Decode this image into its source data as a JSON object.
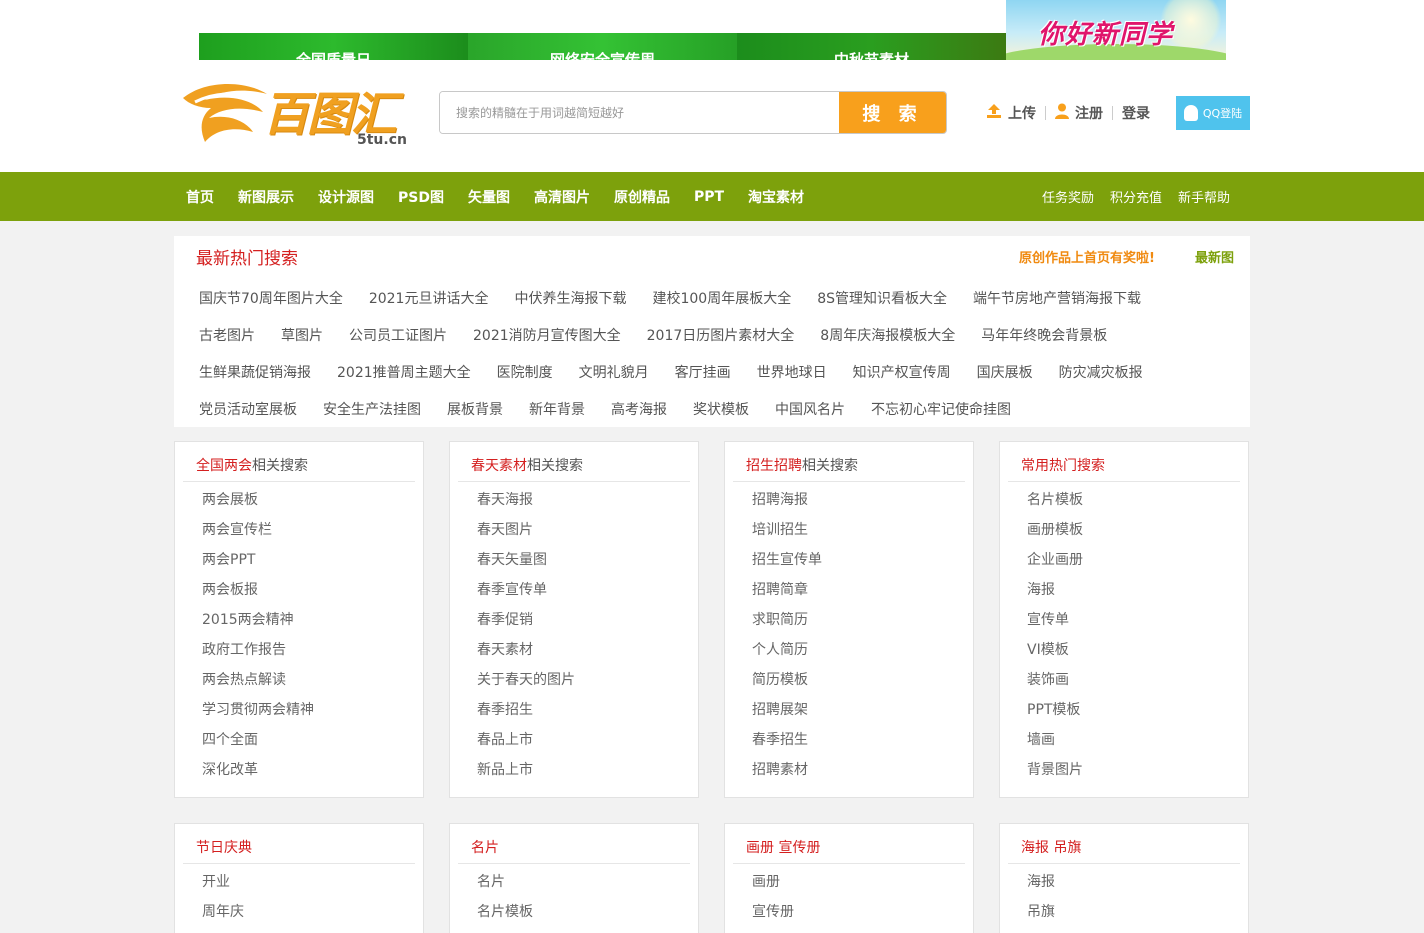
{
  "top_banners": [
    "全国质量日",
    "网络安全宣传周",
    "中秋节素材"
  ],
  "promo": {
    "text": "你好新同学"
  },
  "logo": {
    "name": "百图汇",
    "domain": "5tu.cn"
  },
  "search": {
    "placeholder": "搜索的精髓在于用词越简短越好",
    "button": "搜 索"
  },
  "user_links": {
    "upload": "上传",
    "register": "注册",
    "login": "登录",
    "qq_login": "QQ登陆"
  },
  "nav": {
    "items": [
      "首页",
      "新图展示",
      "设计源图",
      "PSD图",
      "矢量图",
      "高清图片",
      "原创精品",
      "PPT",
      "淘宝素材"
    ],
    "right": [
      "任务奖励",
      "积分充值",
      "新手帮助"
    ]
  },
  "hot_search": {
    "title": "最新热门搜索",
    "promo": "原创作品上首页有奖啦!",
    "latest": "最新图",
    "rows": [
      [
        "国庆节70周年图片大全",
        "2021元旦讲话大全",
        "中伏养生海报下载",
        "建校100周年展板大全",
        "8S管理知识看板大全",
        "端午节房地产营销海报下载"
      ],
      [
        "古老图片",
        "草图片",
        "公司员工证图片",
        "2021消防月宣传图大全",
        "2017日历图片素材大全",
        "8周年庆海报模板大全",
        "马年年终晚会背景板"
      ],
      [
        "生鲜果蔬促销海报",
        "2021推普周主题大全",
        "医院制度",
        "文明礼貌月",
        "客厅挂画",
        "世界地球日",
        "知识产权宣传周",
        "国庆展板",
        "防灾减灾板报"
      ],
      [
        "党员活动室展板",
        "安全生产法挂图",
        "展板背景",
        "新年背景",
        "高考海报",
        "奖状模板",
        "中国风名片",
        "不忘初心牢记使命挂图"
      ]
    ]
  },
  "categories_row1": [
    {
      "key": "全国两会",
      "suffix": "相关搜索",
      "items": [
        "两会展板",
        "两会宣传栏",
        "两会PPT",
        "两会板报",
        "2015两会精神",
        "政府工作报告",
        "两会热点解读",
        "学习贯彻两会精神",
        "四个全面",
        "深化改革"
      ]
    },
    {
      "key": "春天素材",
      "suffix": "相关搜索",
      "items": [
        "春天海报",
        "春天图片",
        "春天矢量图",
        "春季宣传单",
        "春季促销",
        "春天素材",
        "关于春天的图片",
        "春季招生",
        "春品上市",
        "新品上市"
      ]
    },
    {
      "key": "招生招聘",
      "suffix": "相关搜索",
      "items": [
        "招聘海报",
        "培训招生",
        "招生宣传单",
        "招聘简章",
        "求职简历",
        "个人简历",
        "简历模板",
        "招聘展架",
        "春季招生",
        "招聘素材"
      ]
    },
    {
      "key": "常用热门搜索",
      "suffix": "",
      "items": [
        "名片模板",
        "画册模板",
        "企业画册",
        "海报",
        "宣传单",
        "VI模板",
        "装饰画",
        "PPT模板",
        "墙画",
        "背景图片"
      ]
    }
  ],
  "categories_row2": [
    {
      "key": "节日庆典",
      "suffix": "",
      "items": [
        "开业",
        "周年庆"
      ]
    },
    {
      "key": "名片",
      "suffix": "",
      "items": [
        "名片",
        "名片模板"
      ]
    },
    {
      "key": "画册 宣传册",
      "suffix": "",
      "items": [
        "画册",
        "宣传册"
      ]
    },
    {
      "key": "海报 吊旗",
      "suffix": "",
      "items": [
        "海报",
        "吊旗"
      ]
    }
  ],
  "colors": {
    "nav_bg": "#7da10c",
    "accent_orange": "#f8a01c",
    "hot_red": "#d42020",
    "qq_blue": "#4fc3ed"
  }
}
